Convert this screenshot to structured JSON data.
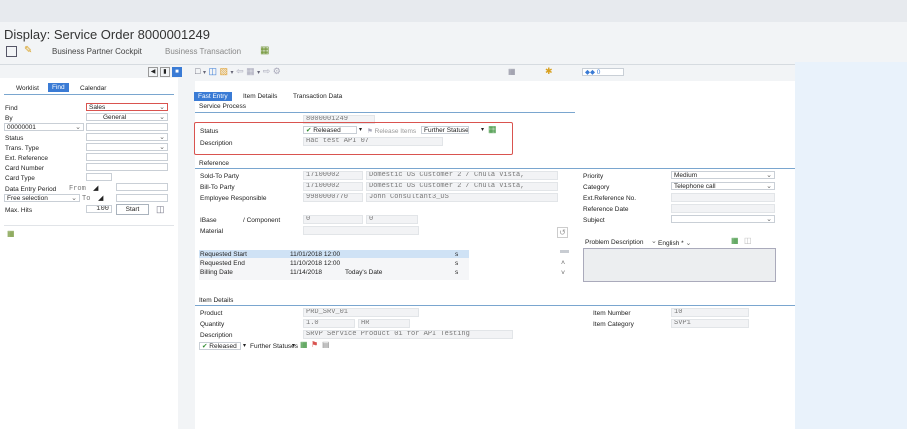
{
  "window": {
    "title": "Display: Service Order 8000001249"
  },
  "toolbar": {
    "business_partner_cockpit": "Business Partner Cockpit",
    "business_transaction": "Business Transaction"
  },
  "left": {
    "tabs": [
      "Worklist",
      "Find",
      "Calendar"
    ],
    "find_label": "Find",
    "find_value": "Sales",
    "by_label": "By",
    "by_value": "General",
    "id_value": "00000001",
    "status_label": "Status",
    "trans_type_label": "Trans. Type",
    "ext_ref_label": "Ext. Reference",
    "card_number_label": "Card Number",
    "card_type_label": "Card Type",
    "data_entry_label": "Data Entry Period",
    "from_label": "From",
    "free_sel_label": "Free selection",
    "to_label": "To",
    "max_hits_label": "Max. Hits",
    "max_hits_value": "100",
    "start_label": "Start"
  },
  "main": {
    "tabs": [
      "Fast Entry",
      "Item Details",
      "Transaction Data"
    ],
    "service_process": "Service Process",
    "order_number": "8000001249",
    "status_label": "Status",
    "status_value": "Released",
    "release_items": "Release Items",
    "further_statuses": "Further Statuses",
    "description_label": "Description",
    "description_value": "Hac test API 07",
    "reference_title": "Reference",
    "sold_to_label": "Sold-To Party",
    "sold_to_id": "17100002",
    "sold_to_name": "Domestic US Customer 2 / Chula Vista,",
    "bill_to_label": "Bill-To Party",
    "bill_to_id": "17100002",
    "bill_to_name": "Domestic US Customer 2 / Chula Vista,",
    "emp_label": "Employee Responsible",
    "emp_id": "9980000770",
    "emp_name": "John Consultant3_US",
    "ibase_label": "IBase",
    "component_label": "/ Component",
    "ibase_value": "0",
    "component_value": "0",
    "material_label": "Material",
    "priority_label": "Priority",
    "priority_value": "Medium",
    "category_label": "Category",
    "category_value": "Telephone call",
    "ext_ref_label": "Ext.Reference No.",
    "ref_date_label": "Reference Date",
    "subject_label": "Subject",
    "problem_desc": "Problem Description",
    "language": "English *",
    "dates": [
      {
        "label": "Requested Start",
        "value": "11/01/2018 12:00",
        "extra": ""
      },
      {
        "label": "Requested End",
        "value": "11/10/2018 12:00",
        "extra": ""
      },
      {
        "label": "Billing Date",
        "value": "11/14/2018",
        "extra": "Today's Date"
      }
    ],
    "item_details_title": "Item Details",
    "product_label": "Product",
    "product_value": "PRD_SRV_01",
    "quantity_label": "Quantity",
    "quantity_value": "1.0",
    "quantity_unit": "HR",
    "item_desc_label": "Description",
    "item_desc_value": "SRVP Service Product 01 for API Testing",
    "item_number_label": "Item Number",
    "item_number_value": "10",
    "item_category_label": "Item Category",
    "item_category_value": "SVP1",
    "item_status": "Released",
    "item_further_statuses": "Further Statuses"
  },
  "colors": {
    "accent": "#3a7bd5",
    "highlight": "#d9534f",
    "ok": "#2e8b2e"
  }
}
